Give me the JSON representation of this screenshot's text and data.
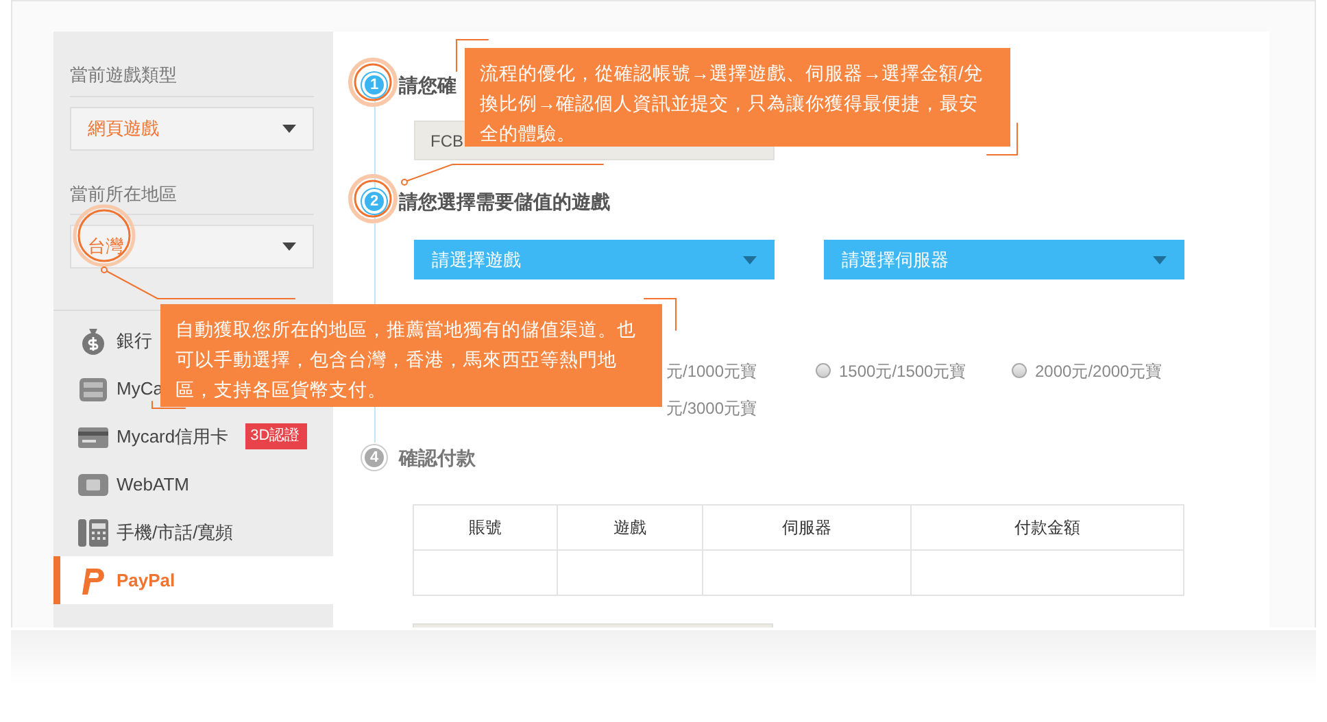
{
  "sidebar": {
    "game_type": {
      "label": "當前遊戲類型",
      "value": "網頁遊戲"
    },
    "region": {
      "label": "當前所在地區",
      "value": "台灣"
    },
    "payment_methods": [
      {
        "label": "銀行",
        "selected": false
      },
      {
        "label": "MyCa",
        "selected": false
      },
      {
        "label": "Mycard信用卡",
        "selected": false,
        "badge": "3D認證"
      },
      {
        "label": "WebATM",
        "selected": false
      },
      {
        "label": "手機/市話/寬頻",
        "selected": false
      },
      {
        "label": "PayPal",
        "selected": true
      }
    ]
  },
  "steps": [
    {
      "number": "1",
      "title": "請您確",
      "active": true
    },
    {
      "number": "2",
      "title": "請您選擇需要儲值的遊戲",
      "active": true
    },
    {
      "number": "4",
      "title": "確認付款",
      "active": false
    }
  ],
  "account_field": {
    "value": "FCB"
  },
  "game_select": {
    "value": "請選擇遊戲"
  },
  "server_select": {
    "value": "請選擇伺服器"
  },
  "amount_rows": [
    [
      {},
      {
        "label": "元/1000元寶"
      },
      {
        "label": "1500元/1500元寶",
        "selected": false
      },
      {
        "label": "2000元/2000元寶",
        "selected": false
      }
    ],
    [
      {},
      {
        "label": "元/3000元寶"
      }
    ]
  ],
  "summary_table": {
    "columns": [
      "賬號",
      "遊戲",
      "伺服器",
      "付款金額"
    ]
  },
  "callouts": [
    {
      "text": "流程的優化，從確認帳號→選擇遊戲、伺服器→選擇金額/兌換比例→確認個人資訊並提交，只為讓你獲得最便捷，最安全的體驗。"
    },
    {
      "text": "自動獲取您所在的地區，推薦當地獨有的儲值渠道。也可以手動選擇，包含台灣，香港，馬來西亞等熱門地區，支持各區貨幣支付。"
    }
  ]
}
